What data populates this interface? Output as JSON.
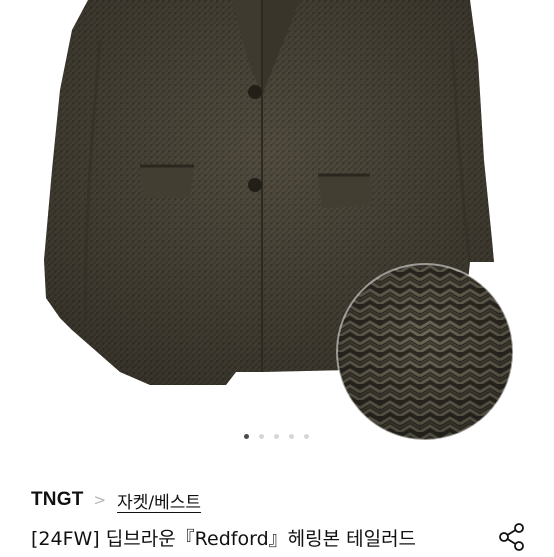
{
  "product": {
    "brand": "TNGT",
    "category": "자켓/베스트",
    "title": "[24FW] 딥브라운『Redford』헤링본 테일러드"
  },
  "gallery": {
    "total_images": 5,
    "active_index": 0
  },
  "icons": {
    "breadcrumb_separator": "chevron-right-icon",
    "share": "share-icon"
  },
  "colors": {
    "jacket": "#4b4639",
    "active_dot": "#4a4a4a",
    "inactive_dot": "#d6d6d6",
    "separator": "#b5b5b5"
  }
}
